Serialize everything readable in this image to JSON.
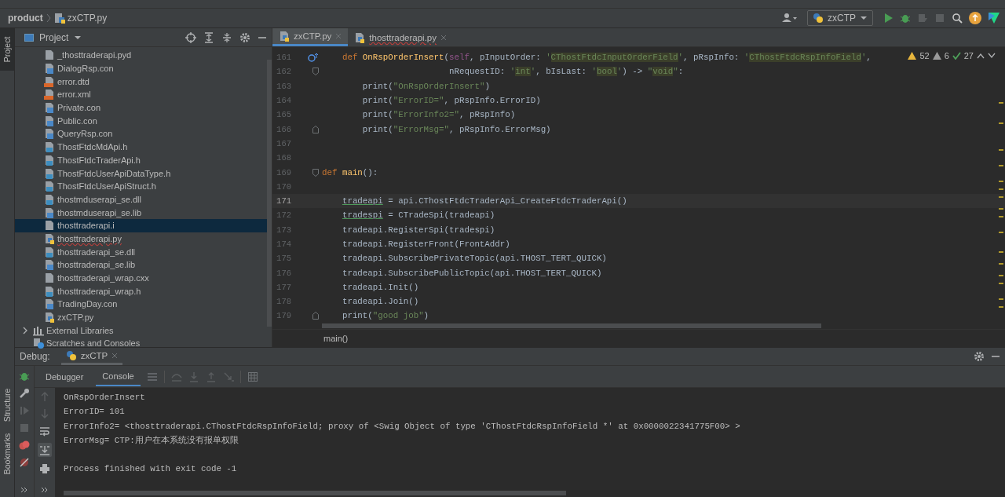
{
  "navbar": {
    "breadcrumbs": [
      "product",
      "zxCTP.py"
    ],
    "run_config": "zxCTP"
  },
  "left_stripe": {
    "top": [
      {
        "label": "Project",
        "selected": true
      }
    ],
    "bottom": [
      {
        "label": "Structure",
        "selected": false
      },
      {
        "label": "Bookmarks",
        "selected": false
      }
    ]
  },
  "project_panel": {
    "title": "Project",
    "items": [
      {
        "label": "_thosttraderapi.pyd",
        "kind": "text",
        "selected": false,
        "error": false
      },
      {
        "label": "DialogRsp.con",
        "kind": "config",
        "selected": false,
        "error": false
      },
      {
        "label": "error.dtd",
        "kind": "markup",
        "selected": false,
        "error": false
      },
      {
        "label": "error.xml",
        "kind": "markup",
        "selected": false,
        "error": false
      },
      {
        "label": "Private.con",
        "kind": "config",
        "selected": false,
        "error": false
      },
      {
        "label": "Public.con",
        "kind": "config",
        "selected": false,
        "error": false
      },
      {
        "label": "QueryRsp.con",
        "kind": "config",
        "selected": false,
        "error": false
      },
      {
        "label": "ThostFtdcMdApi.h",
        "kind": "native",
        "selected": false,
        "error": false
      },
      {
        "label": "ThostFtdcTraderApi.h",
        "kind": "native",
        "selected": false,
        "error": false
      },
      {
        "label": "ThostFtdcUserApiDataType.h",
        "kind": "native",
        "selected": false,
        "error": false
      },
      {
        "label": "ThostFtdcUserApiStruct.h",
        "kind": "native",
        "selected": false,
        "error": false
      },
      {
        "label": "thostmduserapi_se.dll",
        "kind": "native",
        "selected": false,
        "error": false
      },
      {
        "label": "thostmduserapi_se.lib",
        "kind": "config",
        "selected": false,
        "error": false
      },
      {
        "label": "thosttraderapi.i",
        "kind": "text",
        "selected": true,
        "error": false
      },
      {
        "label": "thosttraderapi.py",
        "kind": "python",
        "selected": false,
        "error": true
      },
      {
        "label": "thosttraderapi_se.dll",
        "kind": "native",
        "selected": false,
        "error": false
      },
      {
        "label": "thosttraderapi_se.lib",
        "kind": "config",
        "selected": false,
        "error": false
      },
      {
        "label": "thosttraderapi_wrap.cxx",
        "kind": "text",
        "selected": false,
        "error": false
      },
      {
        "label": "thosttraderapi_wrap.h",
        "kind": "native",
        "selected": false,
        "error": false
      },
      {
        "label": "TradingDay.con",
        "kind": "config",
        "selected": false,
        "error": false
      },
      {
        "label": "zxCTP.py",
        "kind": "python",
        "selected": false,
        "error": false
      }
    ],
    "roots": [
      {
        "label": "External Libraries",
        "kind": "libraries",
        "expanded": false
      },
      {
        "label": "Scratches and Consoles",
        "kind": "scratches"
      }
    ]
  },
  "editor": {
    "tabs": [
      {
        "label": "zxCTP.py",
        "selected": true,
        "error": false
      },
      {
        "label": "thosttraderapi.py",
        "selected": false,
        "error": true
      }
    ],
    "inspections": {
      "warnings": "52",
      "weak_warnings": "6",
      "ok": "27"
    },
    "lines": [
      {
        "number": "161",
        "current": false,
        "override": true,
        "fold_start": false,
        "fold_end": false,
        "tokens": [
          {
            "text": "    def ",
            "kind": "kw"
          },
          {
            "text": "OnRspOrderInsert",
            "kind": "fn"
          },
          {
            "text": "(",
            "kind": "plain"
          },
          {
            "text": "self",
            "kind": "self"
          },
          {
            "text": ", pInputOrder: ",
            "kind": "plain"
          },
          {
            "text": "'",
            "kind": "str"
          },
          {
            "text": "CThostFtdcInputOrderField",
            "kind": "type"
          },
          {
            "text": "'",
            "kind": "str"
          },
          {
            "text": ", pRspInfo: ",
            "kind": "plain"
          },
          {
            "text": "'",
            "kind": "str"
          },
          {
            "text": "CThostFtdcRspInfoField",
            "kind": "type"
          },
          {
            "text": "'",
            "kind": "str"
          },
          {
            "text": ",",
            "kind": "plain"
          }
        ]
      },
      {
        "number": "162",
        "current": false,
        "override": false,
        "fold_start": true,
        "fold_end": false,
        "tokens": [
          {
            "text": "                         nRequestID: ",
            "kind": "plain"
          },
          {
            "text": "'",
            "kind": "str"
          },
          {
            "text": "int",
            "kind": "type"
          },
          {
            "text": "'",
            "kind": "str"
          },
          {
            "text": ", bIsLast: ",
            "kind": "plain"
          },
          {
            "text": "'",
            "kind": "str"
          },
          {
            "text": "bool",
            "kind": "type"
          },
          {
            "text": "'",
            "kind": "str"
          },
          {
            "text": ") -> ",
            "kind": "plain"
          },
          {
            "text": "\"",
            "kind": "str"
          },
          {
            "text": "void",
            "kind": "type"
          },
          {
            "text": "\"",
            "kind": "str"
          },
          {
            "text": ":",
            "kind": "plain"
          }
        ]
      },
      {
        "number": "163",
        "current": false,
        "override": false,
        "fold_start": false,
        "fold_end": false,
        "tokens": [
          {
            "text": "        print(",
            "kind": "plain"
          },
          {
            "text": "\"OnRspOrderInsert\"",
            "kind": "str"
          },
          {
            "text": ")",
            "kind": "plain"
          }
        ]
      },
      {
        "number": "164",
        "current": false,
        "override": false,
        "fold_start": false,
        "fold_end": false,
        "tokens": [
          {
            "text": "        print(",
            "kind": "plain"
          },
          {
            "text": "\"ErrorID=\"",
            "kind": "str"
          },
          {
            "text": ", pRspInfo.ErrorID)",
            "kind": "plain"
          }
        ]
      },
      {
        "number": "165",
        "current": false,
        "override": false,
        "fold_start": false,
        "fold_end": false,
        "tokens": [
          {
            "text": "        print(",
            "kind": "plain"
          },
          {
            "text": "\"ErrorInfo2=\"",
            "kind": "str"
          },
          {
            "text": ", pRspInfo)",
            "kind": "plain"
          }
        ]
      },
      {
        "number": "166",
        "current": false,
        "override": false,
        "fold_start": false,
        "fold_end": true,
        "tokens": [
          {
            "text": "        print(",
            "kind": "plain"
          },
          {
            "text": "\"ErrorMsg=\"",
            "kind": "str"
          },
          {
            "text": ", pRspInfo.ErrorMsg)",
            "kind": "plain"
          }
        ]
      },
      {
        "number": "167",
        "current": false,
        "override": false,
        "fold_start": false,
        "fold_end": false
      },
      {
        "number": "168",
        "current": false,
        "override": false,
        "fold_start": false,
        "fold_end": false
      },
      {
        "number": "169",
        "current": false,
        "override": false,
        "fold_start": true,
        "fold_end": false,
        "tokens": [
          {
            "text": "def ",
            "kind": "kw"
          },
          {
            "text": "main",
            "kind": "fn"
          },
          {
            "text": "():",
            "kind": "plain"
          }
        ]
      },
      {
        "number": "170",
        "current": false,
        "override": false,
        "fold_start": false,
        "fold_end": false
      },
      {
        "number": "171",
        "current": true,
        "override": false,
        "fold_start": false,
        "fold_end": false,
        "tokens": [
          {
            "text": "    tradeapi",
            "kind": "underlined"
          },
          {
            "text": " = api.CThostFtdcTraderApi_CreateFtdcTraderApi()",
            "kind": "plain"
          }
        ]
      },
      {
        "number": "172",
        "current": false,
        "override": false,
        "fold_start": false,
        "fold_end": false,
        "tokens": [
          {
            "text": "    tradespi",
            "kind": "underlined"
          },
          {
            "text": " = CTradeSpi(tradeapi)",
            "kind": "plain"
          }
        ]
      },
      {
        "number": "173",
        "current": false,
        "override": false,
        "fold_start": false,
        "fold_end": false,
        "tokens": [
          {
            "text": "    tradeapi.RegisterSpi(tradespi)",
            "kind": "plain"
          }
        ]
      },
      {
        "number": "174",
        "current": false,
        "override": false,
        "fold_start": false,
        "fold_end": false,
        "tokens": [
          {
            "text": "    tradeapi.RegisterFront(FrontAddr)",
            "kind": "plain"
          }
        ]
      },
      {
        "number": "175",
        "current": false,
        "override": false,
        "fold_start": false,
        "fold_end": false,
        "tokens": [
          {
            "text": "    tradeapi.SubscribePrivateTopic(api.THOST_TERT_QUICK)",
            "kind": "plain"
          }
        ]
      },
      {
        "number": "176",
        "current": false,
        "override": false,
        "fold_start": false,
        "fold_end": false,
        "tokens": [
          {
            "text": "    tradeapi.SubscribePublicTopic(api.THOST_TERT_QUICK)",
            "kind": "plain"
          }
        ]
      },
      {
        "number": "177",
        "current": false,
        "override": false,
        "fold_start": false,
        "fold_end": false,
        "tokens": [
          {
            "text": "    tradeapi.Init()",
            "kind": "plain"
          }
        ]
      },
      {
        "number": "178",
        "current": false,
        "override": false,
        "fold_start": false,
        "fold_end": false,
        "tokens": [
          {
            "text": "    tradeapi.Join()",
            "kind": "plain"
          }
        ]
      },
      {
        "number": "179",
        "current": false,
        "override": false,
        "fold_start": false,
        "fold_end": true,
        "tokens": [
          {
            "text": "    print(",
            "kind": "plain"
          },
          {
            "text": "\"good job\"",
            "kind": "str"
          },
          {
            "text": ")",
            "kind": "plain"
          }
        ]
      }
    ],
    "breadcrumb": "main()"
  },
  "debug": {
    "title": "Debug:",
    "session_tab": "zxCTP",
    "tabs": [
      {
        "label": "Debugger",
        "selected": false
      },
      {
        "label": "Console",
        "selected": true
      }
    ],
    "output": [
      {
        "text": "OnRspOrderInsert",
        "kind": "stdout"
      },
      {
        "text": "ErrorID= 101",
        "kind": "stdout"
      },
      {
        "text": "ErrorInfo2= <thosttraderapi.CThostFtdcRspInfoField; proxy of <Swig Object of type 'CThostFtdcRspInfoField *' at 0x0000022341775F00> >",
        "kind": "stdout"
      },
      {
        "text": "ErrorMsg= CTP:用户在本系统没有报单权限",
        "kind": "stdout"
      },
      {
        "text": "Process finished with exit code -1",
        "kind": "exit"
      }
    ]
  }
}
